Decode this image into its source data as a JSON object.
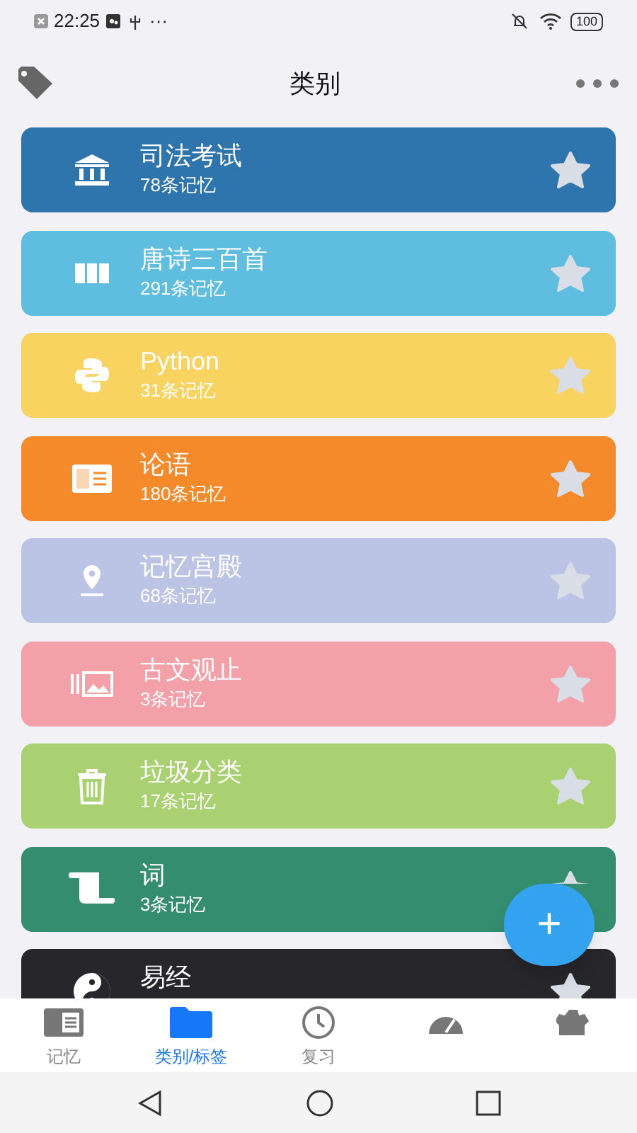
{
  "status_bar": {
    "time": "22:25",
    "dots": "···",
    "battery": "100"
  },
  "header": {
    "title": "类别"
  },
  "categories": [
    {
      "name": "司法考试",
      "count": "78条记忆",
      "color": "#2f75ad",
      "kind": "bank"
    },
    {
      "name": "唐诗三百首",
      "count": "291条记忆",
      "color": "#5fbedf",
      "kind": "columns"
    },
    {
      "name": "Python",
      "count": "31条记忆",
      "color": "#f8d35f",
      "kind": "python"
    },
    {
      "name": "论语",
      "count": "180条记忆",
      "color": "#f48a2a",
      "kind": "newspaper"
    },
    {
      "name": "记忆宫殿",
      "count": "68条记忆",
      "color": "#bcc4e6",
      "kind": "pin"
    },
    {
      "name": "古文观止",
      "count": "3条记忆",
      "color": "#f3a0a8",
      "kind": "images"
    },
    {
      "name": "垃圾分类",
      "count": "17条记忆",
      "color": "#a9d171",
      "kind": "trash"
    },
    {
      "name": "词",
      "count": "3条记忆",
      "color": "#338d6e",
      "kind": "scroll"
    },
    {
      "name": "易经",
      "color": "#26262b",
      "kind": "yinyang"
    }
  ],
  "fab": {
    "label": "+"
  },
  "tabs": [
    {
      "label": "记忆",
      "selected": false,
      "kind": "news"
    },
    {
      "label": "类别/标签",
      "selected": true,
      "kind": "folder"
    },
    {
      "label": "复习",
      "selected": false,
      "kind": "clock"
    },
    {
      "selected": false,
      "kind": "gauge"
    },
    {
      "selected": false,
      "kind": "gear"
    }
  ]
}
